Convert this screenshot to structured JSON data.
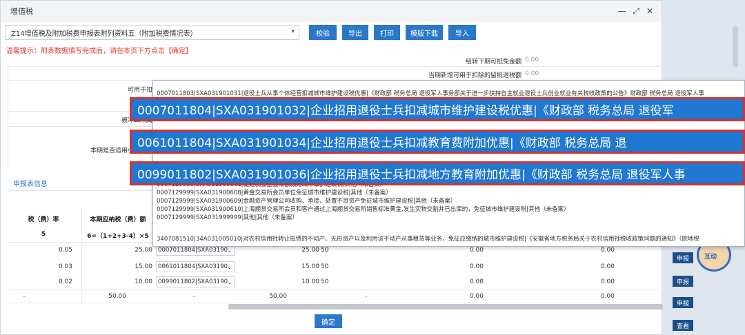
{
  "dialog": {
    "title": "增值税",
    "controls": [
      "—",
      "⤢",
      "✕"
    ]
  },
  "toolbar": {
    "form_select": "Z14增值税及附加税费申报表附列资料五（附加税费情况表）",
    "buttons": [
      "校验",
      "导出",
      "打印",
      "模版下载",
      "导入"
    ]
  },
  "warning": "温馨提示：附表数据填写完成后，请在本页下方点击【确定】",
  "upper_rows": [
    {
      "label": "结转下期可抵免金额",
      "value": "0.00"
    },
    {
      "label": "当期新增可用于扣除的留抵退税额",
      "value": "0.00"
    }
  ],
  "side_labels": {
    "available": "可用于扣",
    "offset": "被冲红所属",
    "small": "本期是否适用小微企业"
  },
  "section_title": "申报表信息",
  "table": {
    "headers": [
      "税（费）率",
      "本期应纳税（费）额"
    ],
    "subheaders": [
      "5",
      "6=（1+2+3-4）×5"
    ],
    "rows": [
      {
        "rate": "0.05",
        "amount": "25.00",
        "code": "0007011804|SXA03190",
        "tax": "25.00",
        "col3": "50",
        "col4": "0.00",
        "col5": "0.00"
      },
      {
        "rate": "0.03",
        "amount": "15.00",
        "code": "0061011804|SXA03190",
        "tax": "15.00",
        "col3": "50",
        "col4": "0.00",
        "col5": "0.00"
      },
      {
        "rate": "0.02",
        "amount": "10.00",
        "code": "0099011802|SXA03190",
        "tax": "10.00",
        "col3": "50",
        "col4": "0.00",
        "col5": "0.00"
      }
    ],
    "total": {
      "rate": "-",
      "amount": "50.00",
      "dash": "-",
      "tax": "50.00",
      "col3": "-",
      "col4": "0.00",
      "col5": "0.00"
    }
  },
  "confirm_label": "确定",
  "dropdown": {
    "top_item": "0007011803|SXA031901031|退役士兵从事个体经营扣减城市维护建设税优惠|《财政部 税务总局 退役军人事务部关于进一步扶持自主就业退役士兵创业就业有关税收政策的公告》财政部 税务总局 退役军人事",
    "highlights": [
      "0007011804|SXA031901032|企业招用退役士兵扣减城市维护建设税优惠|《财政部 税务总局 退役军",
      "0061011804|SXA031901034|企业招用退役士兵扣减教育费附加优惠|《财政部 税务总局 退",
      "0099011802|SXA031901036|企业招用退役士兵扣减地方教育附加优惠|《财政部 税务总局 退役军人事"
    ],
    "items": [
      "0007129999|SXA031900601|促进就业企业限额减免城市维护建设税|其他（未备案）",
      "0007129999|SXA031900608|黄金交易所会员单位免征城市维护建设税|其他（未备案）",
      "0007129999|SXA031900609|金融资产管理公司收购、承接、处置不良资产免征城市维护建设税|其他（未备案）",
      "0007129999|SXA031900610|上海期货交易所会员和客户通过上海期货交易所销售标准黄金,发生实物交割并已出库的，免征城市维护建设税|其他（未备案）",
      "0007129999|SXA031999999|其他|其他（未备案）"
    ],
    "bottom_item": "3407081510|34A031005010|对农村信用社转让抵债的不动产、无形资产以及利用该不动产从事租赁等业务，免征应缴纳的城市维护建设税|《安徽省地方税务局关于农村信用社税收政策问题的通知》（皖地税"
  },
  "side_buttons": [
    "申报",
    "申报",
    "申报",
    "查看"
  ],
  "avatar_text": "互动"
}
